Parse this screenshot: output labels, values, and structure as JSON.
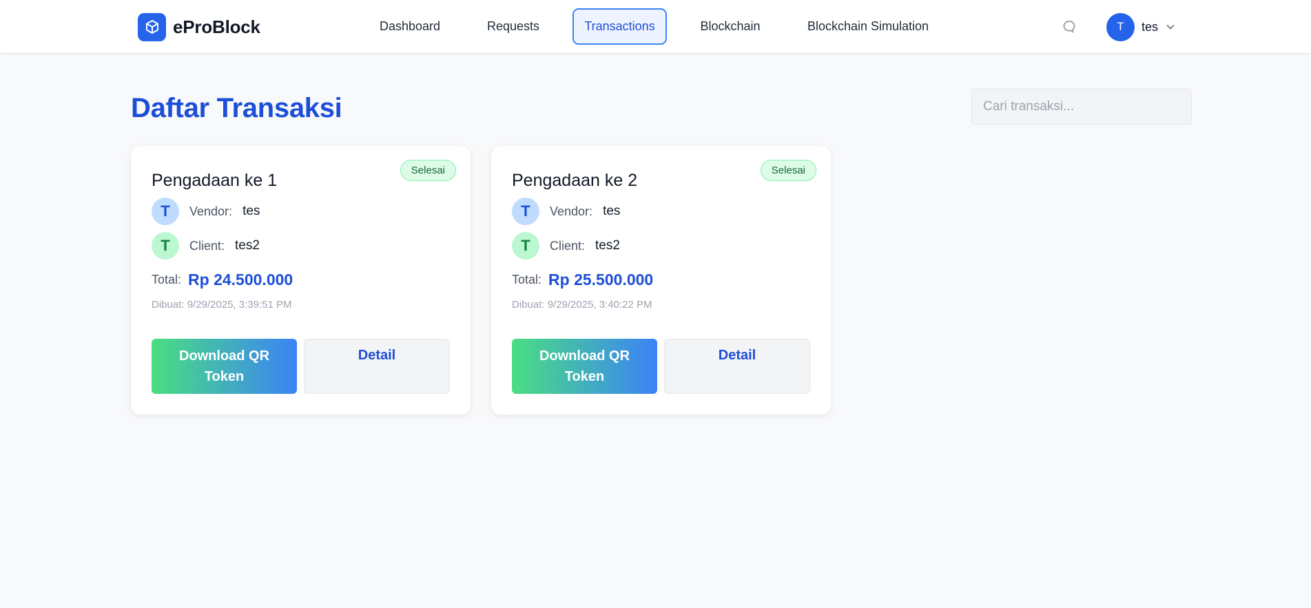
{
  "brand": {
    "name": "eProBlock"
  },
  "nav": [
    {
      "label": "Dashboard",
      "active": false
    },
    {
      "label": "Requests",
      "active": false
    },
    {
      "label": "Transactions",
      "active": true
    },
    {
      "label": "Blockchain",
      "active": false
    },
    {
      "label": "Blockchain Simulation",
      "active": false
    }
  ],
  "user": {
    "initial": "T",
    "name": "tes"
  },
  "page": {
    "title": "Daftar Transaksi",
    "search_placeholder": "Cari transaksi..."
  },
  "labels": {
    "vendor": "Vendor:",
    "client": "Client:",
    "total": "Total:",
    "download_qr": "Download QR Token",
    "detail": "Detail"
  },
  "transactions": [
    {
      "title": "Pengadaan ke 1",
      "status": "Selesai",
      "vendor_initial": "T",
      "vendor": "tes",
      "client_initial": "T",
      "client": "tes2",
      "total": "Rp 24.500.000",
      "created": "Dibuat: 9/29/2025, 3:39:51 PM"
    },
    {
      "title": "Pengadaan ke 2",
      "status": "Selesai",
      "vendor_initial": "T",
      "vendor": "tes",
      "client_initial": "T",
      "client": "tes2",
      "total": "Rp 25.500.000",
      "created": "Dibuat: 9/29/2025, 3:40:22 PM"
    }
  ],
  "colors": {
    "primary": "#2563eb",
    "title": "#1d4ed8",
    "success_bg": "#dcfce7",
    "success_text": "#166534",
    "gradient_start": "#4ade80",
    "gradient_end": "#3b82f6"
  },
  "icons": {
    "brand": "cube-icon",
    "notification": "chat-bubble-icon",
    "user_menu": "chevron-down-icon"
  }
}
